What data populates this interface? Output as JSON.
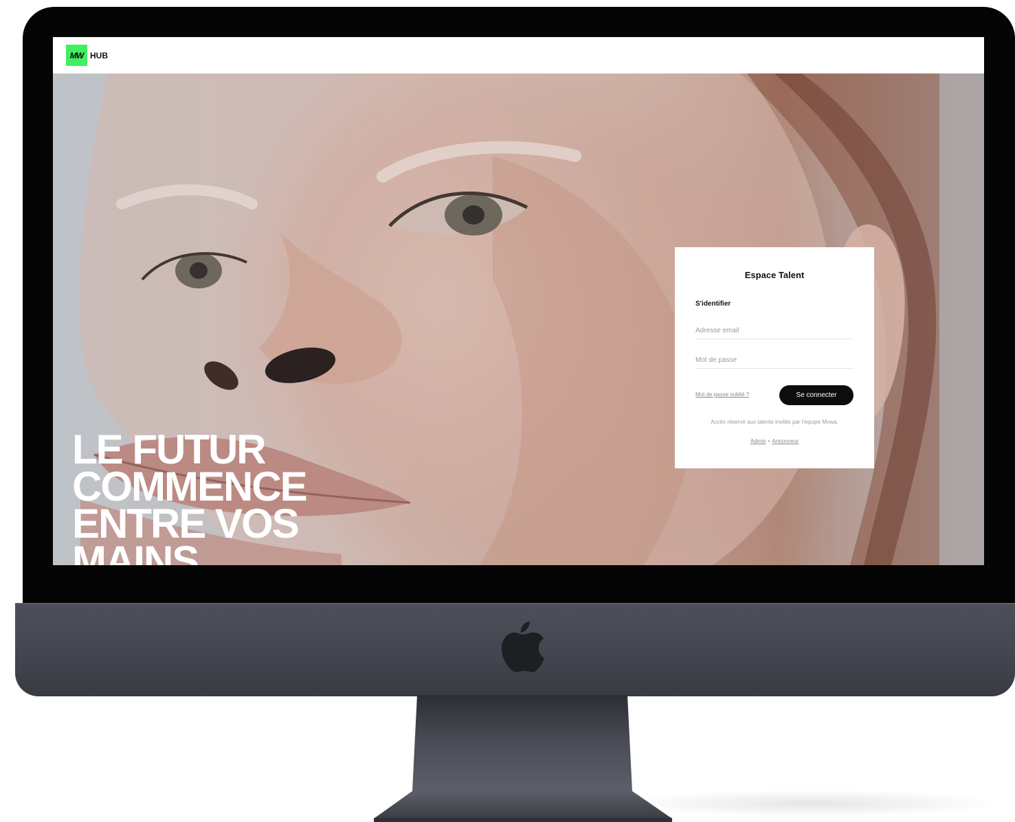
{
  "header": {
    "logo_mark": "MW",
    "logo_text": "HUB"
  },
  "hero": {
    "headline_lines": [
      "LE FUTUR",
      "COMMENCE",
      "ENTRE VOS",
      "MAINS"
    ]
  },
  "login": {
    "title": "Espace Talent",
    "subtitle": "S'identifier",
    "email_placeholder": "Adresse email",
    "password_placeholder": "Mot de passe",
    "forgot_password": "Mot de passe oublié ?",
    "submit_label": "Se connecter",
    "access_note": "Accès réservé aux talents invités par l'équipe Mowa.",
    "admin_link": "Admin",
    "separator": "•",
    "advertiser_link": "Annonceur"
  },
  "colors": {
    "brand_green": "#3ff05f",
    "button_black": "#0d0d0d",
    "device_bezel": "#050505",
    "device_body": "#43464f"
  },
  "icons": {
    "device_logo": "apple-icon"
  }
}
